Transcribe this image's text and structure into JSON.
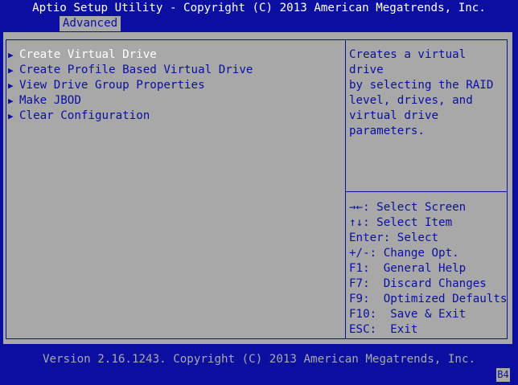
{
  "header": {
    "title": "Aptio Setup Utility - Copyright (C) 2013 American Megatrends, Inc.",
    "tab": "Advanced"
  },
  "menu": {
    "arrow_icon": "right-triangle-icon",
    "items": [
      {
        "label": "Create Virtual Drive"
      },
      {
        "label": "Create Profile Based Virtual Drive"
      },
      {
        "label": "View Drive Group Properties"
      },
      {
        "label": "Make JBOD"
      },
      {
        "label": "Clear Configuration"
      }
    ]
  },
  "help": {
    "text": "Creates a virtual drive\nby selecting the RAID\nlevel, drives, and\nvirtual drive\nparameters."
  },
  "keys": [
    {
      "key": "→←",
      "desc": ": Select Screen"
    },
    {
      "key": "↑↓",
      "desc": ": Select Item"
    },
    {
      "key": "Enter",
      "desc": ": Select"
    },
    {
      "key": "+/-",
      "desc": ": Change Opt."
    },
    {
      "key": "F1",
      "desc": ":  General Help"
    },
    {
      "key": "F7",
      "desc": ":  Discard Changes"
    },
    {
      "key": "F9",
      "desc": ":  Optimized Defaults"
    },
    {
      "key": "F10",
      "desc": ":  Save & Exit"
    },
    {
      "key": "ESC",
      "desc": ":  Exit"
    }
  ],
  "footer": {
    "version": "Version 2.16.1243. Copyright (C) 2013 American Megatrends, Inc.",
    "badge": "B4"
  },
  "colors": {
    "background": "#0a0fa0",
    "panel": "#a8a8a8",
    "highlight_text": "#ffffff"
  }
}
